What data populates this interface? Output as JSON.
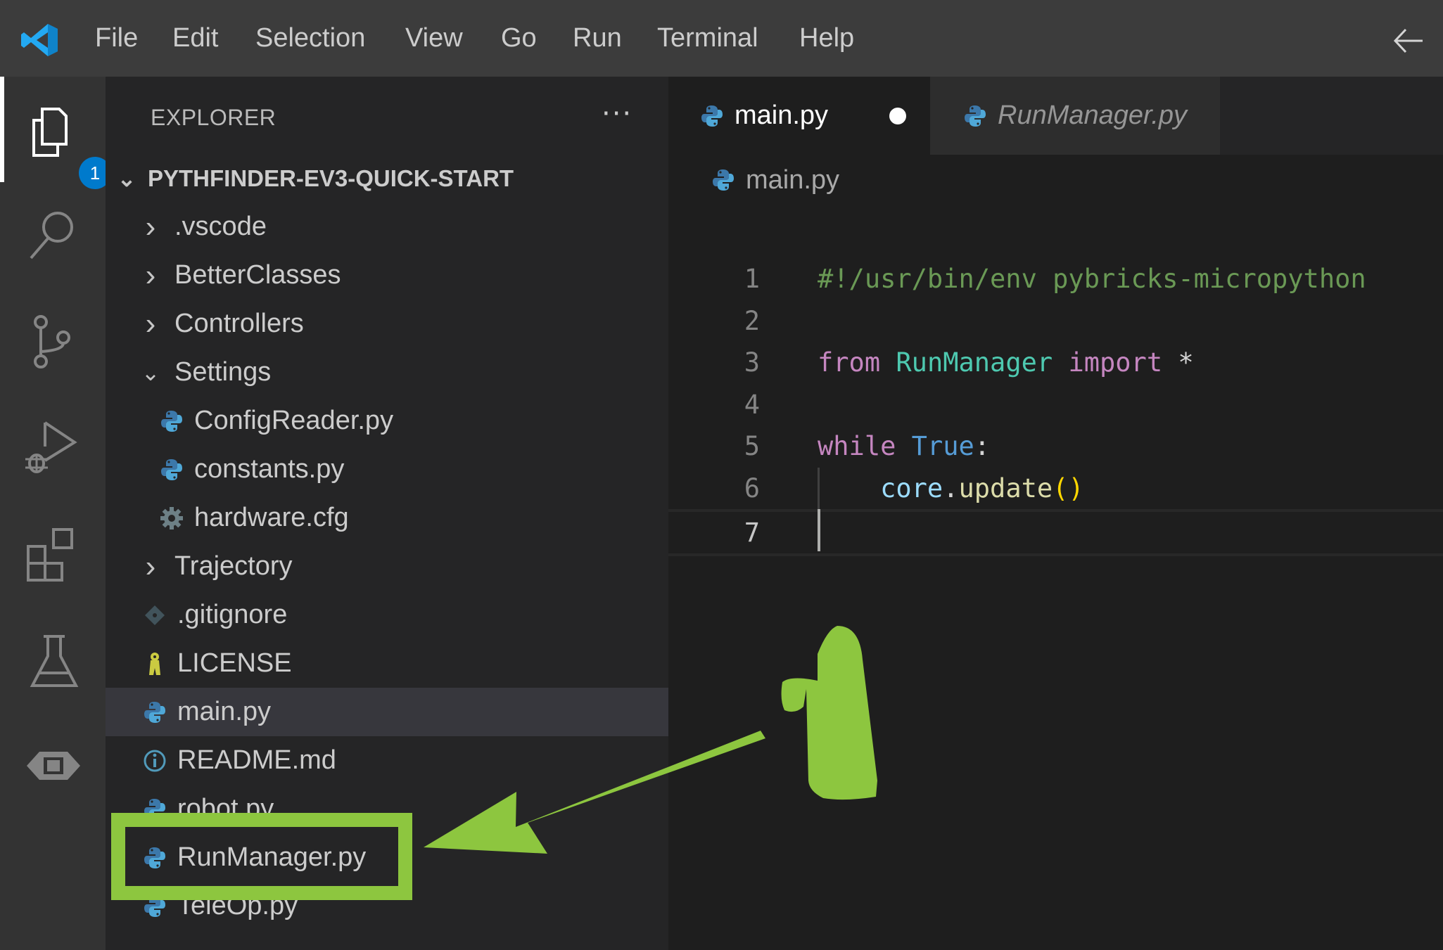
{
  "menu": {
    "items": [
      "File",
      "Edit",
      "Selection",
      "View",
      "Go",
      "Run",
      "Terminal",
      "Help"
    ]
  },
  "activity_bar": {
    "items": [
      {
        "name": "explorer",
        "icon": "files-icon",
        "badge": "1",
        "active": true
      },
      {
        "name": "search",
        "icon": "search-icon"
      },
      {
        "name": "source-control",
        "icon": "source-control-icon"
      },
      {
        "name": "run-debug",
        "icon": "run-debug-icon"
      },
      {
        "name": "extensions",
        "icon": "extensions-icon"
      },
      {
        "name": "testing",
        "icon": "flask-icon"
      },
      {
        "name": "ev3-device",
        "icon": "ev3-brick-icon"
      }
    ]
  },
  "sidebar": {
    "title": "EXPLORER",
    "more_label": "···",
    "root": "PYTHFINDER-EV3-QUICK-START",
    "tree": [
      {
        "label": ".vscode",
        "type": "folder",
        "expanded": false,
        "depth": 1
      },
      {
        "label": "BetterClasses",
        "type": "folder",
        "expanded": false,
        "depth": 1
      },
      {
        "label": "Controllers",
        "type": "folder",
        "expanded": false,
        "depth": 1
      },
      {
        "label": "Settings",
        "type": "folder",
        "expanded": true,
        "depth": 1
      },
      {
        "label": "ConfigReader.py",
        "type": "python",
        "depth": 2
      },
      {
        "label": "constants.py",
        "type": "python",
        "depth": 2
      },
      {
        "label": "hardware.cfg",
        "type": "config",
        "depth": 2
      },
      {
        "label": "Trajectory",
        "type": "folder",
        "expanded": false,
        "depth": 1
      },
      {
        "label": ".gitignore",
        "type": "git",
        "depth": 1
      },
      {
        "label": "LICENSE",
        "type": "license",
        "depth": 1
      },
      {
        "label": "main.py",
        "type": "python",
        "depth": 1,
        "selected": true
      },
      {
        "label": "README.md",
        "type": "info",
        "depth": 1
      },
      {
        "label": "robot.py",
        "type": "python",
        "depth": 1
      },
      {
        "label": "RunManager.py",
        "type": "python",
        "depth": 1,
        "highlighted": true
      },
      {
        "label": "TeleOp.py",
        "type": "python",
        "depth": 1
      }
    ]
  },
  "editor": {
    "tabs": [
      {
        "label": "main.py",
        "active": true,
        "dirty": true
      },
      {
        "label": "RunManager.py",
        "active": false,
        "preview": true
      }
    ],
    "breadcrumb": "main.py",
    "lines": [
      {
        "n": "1",
        "tokens": [
          {
            "t": "#!/usr/bin/env pybricks-micropython",
            "c": "comment"
          }
        ]
      },
      {
        "n": "2",
        "tokens": []
      },
      {
        "n": "3",
        "tokens": [
          {
            "t": "from",
            "c": "kw"
          },
          {
            "t": " ",
            "c": "op"
          },
          {
            "t": "RunManager",
            "c": "cls"
          },
          {
            "t": " ",
            "c": "op"
          },
          {
            "t": "import",
            "c": "kw"
          },
          {
            "t": " *",
            "c": "op"
          }
        ]
      },
      {
        "n": "4",
        "tokens": []
      },
      {
        "n": "5",
        "tokens": [
          {
            "t": "while",
            "c": "kw"
          },
          {
            "t": " ",
            "c": "op"
          },
          {
            "t": "True",
            "c": "const"
          },
          {
            "t": ":",
            "c": "op"
          }
        ]
      },
      {
        "n": "6",
        "tokens": [
          {
            "t": "    ",
            "c": "op"
          },
          {
            "t": "core",
            "c": "var"
          },
          {
            "t": ".",
            "c": "op"
          },
          {
            "t": "update",
            "c": "fn"
          },
          {
            "t": "()",
            "c": "paren"
          }
        ]
      },
      {
        "n": "7",
        "tokens": [],
        "current": true
      }
    ]
  },
  "annotation": {
    "step_number": "1",
    "target": "RunManager.py",
    "color": "#8dc63f"
  }
}
